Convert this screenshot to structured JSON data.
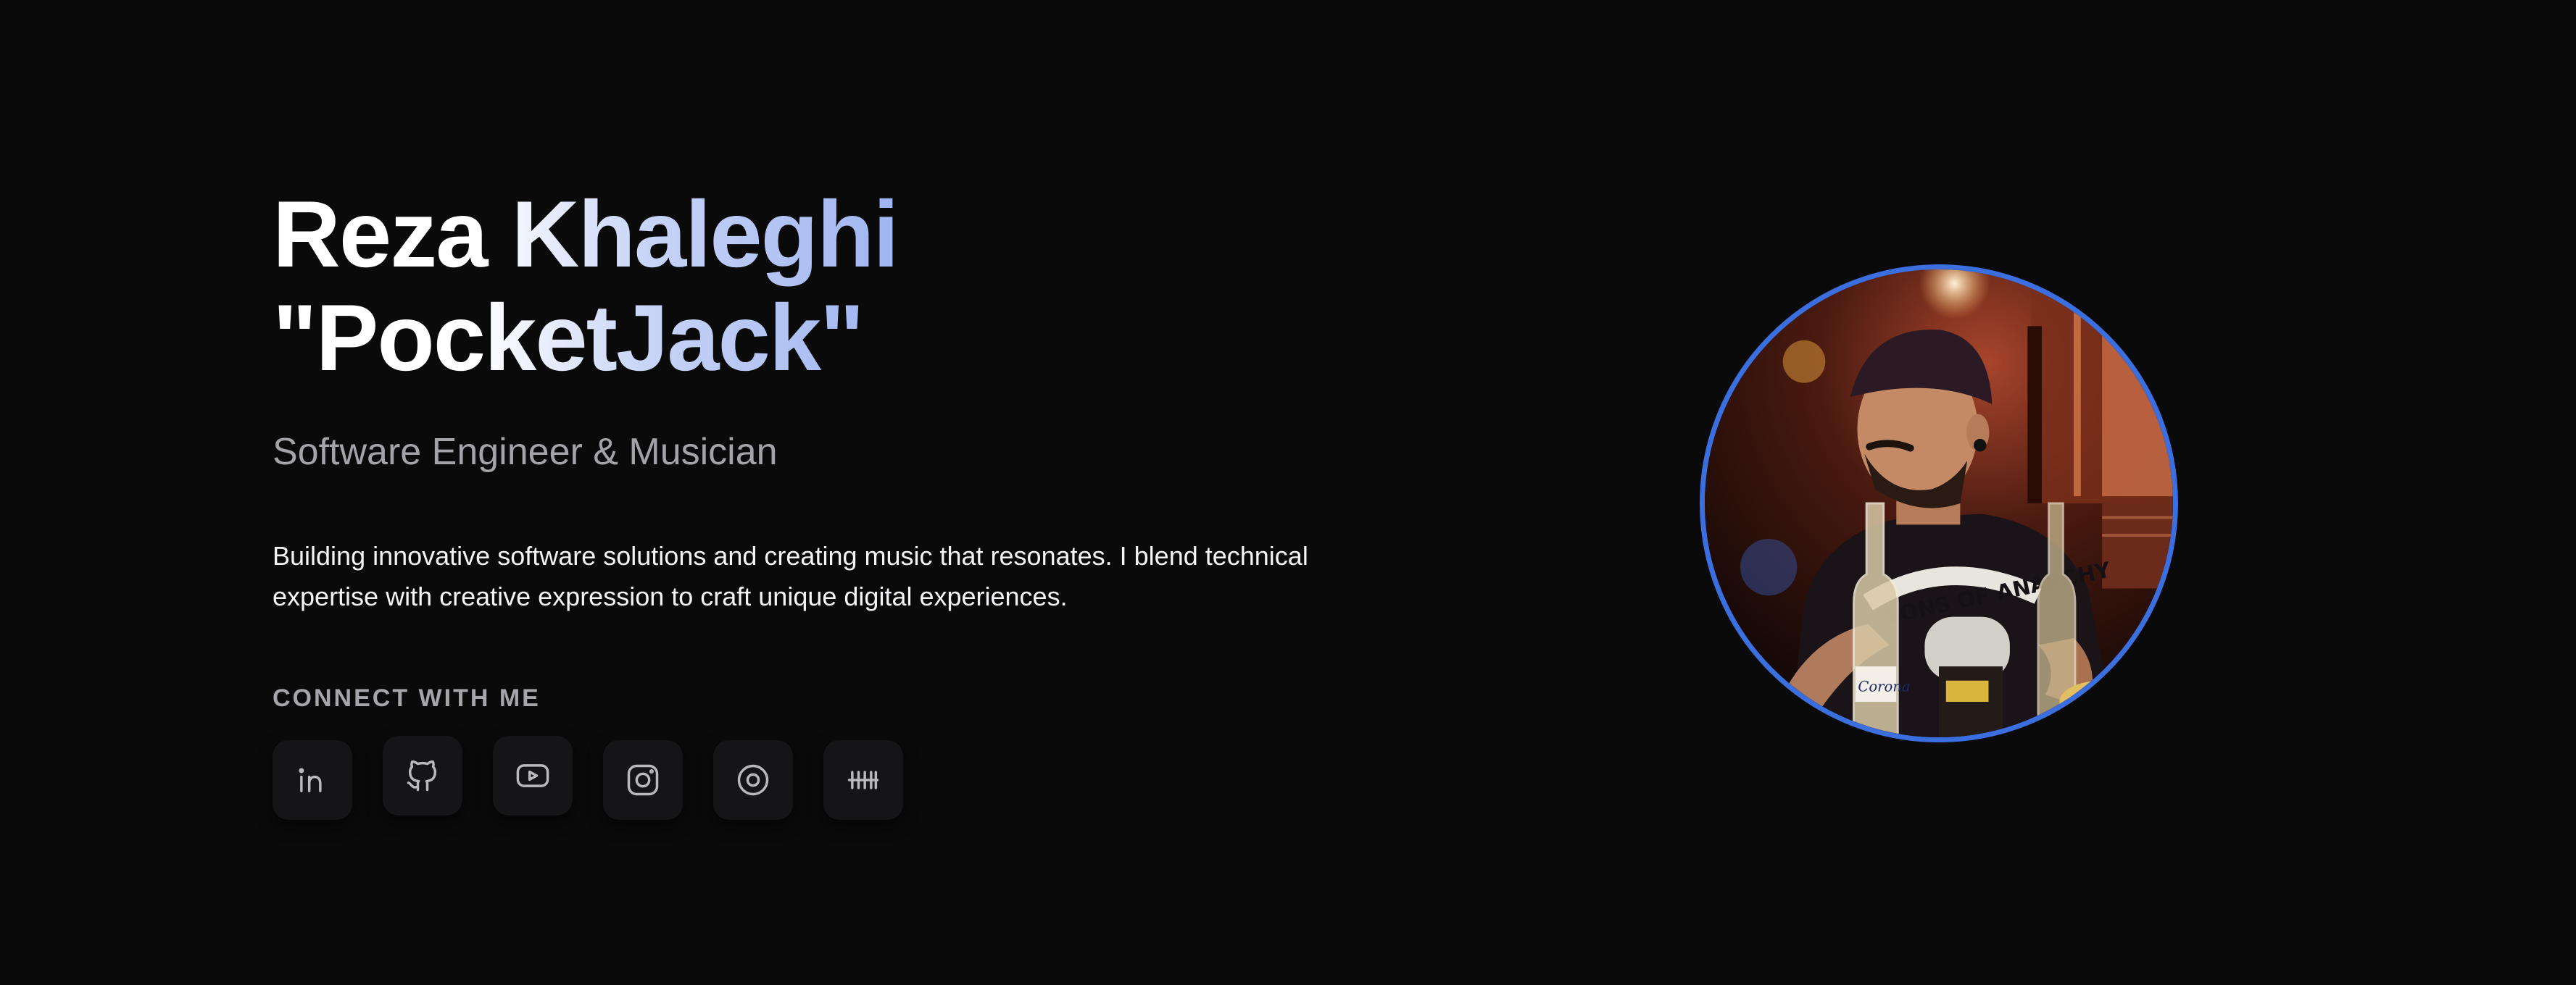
{
  "hero": {
    "name_line1": "Reza Khaleghi",
    "name_line2": "\"PocketJack\"",
    "subtitle": "Software Engineer & Musician",
    "bio": "Building innovative software solutions and creating music that resonates. I blend technical expertise with creative expression to craft unique digital experiences.",
    "connect_label": "CONNECT WITH ME",
    "socials": [
      {
        "icon": "linkedin-icon"
      },
      {
        "icon": "github-icon"
      },
      {
        "icon": "youtube-icon"
      },
      {
        "icon": "instagram-icon"
      },
      {
        "icon": "music-disc-icon"
      },
      {
        "icon": "bandcamp-icon"
      }
    ],
    "photo": {
      "shirt_text": "SONS OF ANARCHY",
      "bottle_label": "Corona"
    }
  },
  "colors": {
    "background": "#0a0a0b",
    "accent": "#3b6fe0",
    "gradient_end": "#8fa8ef",
    "muted_text": "#a3a3a8",
    "button_bg": "#151517"
  }
}
